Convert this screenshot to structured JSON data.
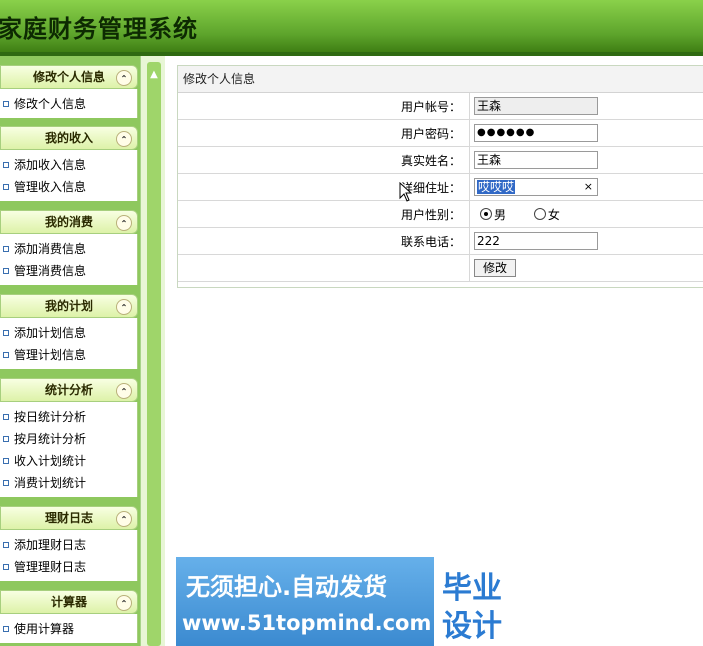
{
  "header": {
    "title": "家庭财务管理系统"
  },
  "sidebar": {
    "groups": [
      {
        "title": "修改个人信息",
        "items": [
          "修改个人信息"
        ]
      },
      {
        "title": "我的收入",
        "items": [
          "添加收入信息",
          "管理收入信息"
        ]
      },
      {
        "title": "我的消费",
        "items": [
          "添加消费信息",
          "管理消费信息"
        ]
      },
      {
        "title": "我的计划",
        "items": [
          "添加计划信息",
          "管理计划信息"
        ]
      },
      {
        "title": "统计分析",
        "items": [
          "按日统计分析",
          "按月统计分析",
          "收入计划统计",
          "消费计划统计"
        ]
      },
      {
        "title": "理财日志",
        "items": [
          "添加理财日志",
          "管理理财日志"
        ]
      },
      {
        "title": "计算器",
        "items": [
          "使用计算器"
        ]
      }
    ]
  },
  "form": {
    "panel_title": "修改个人信息",
    "fields": {
      "account": {
        "label": "用户帐号：",
        "value": "王森"
      },
      "password": {
        "label": "用户密码：",
        "value": "●●●●●●"
      },
      "real_name": {
        "label": "真实姓名：",
        "value": "王森"
      },
      "address": {
        "label": "详细住址：",
        "value": "哎哎哎",
        "clear": "×"
      },
      "gender": {
        "label": "用户性别：",
        "options": [
          "男",
          "女"
        ],
        "selected": "男"
      },
      "phone": {
        "label": "联系电话：",
        "value": "222"
      }
    },
    "submit_label": "修改"
  },
  "watermark": {
    "slogan": "无须担心.自动发货",
    "site": "www.51topmind.com",
    "badge_line1": "毕业",
    "badge_line2": "设计"
  },
  "colors": {
    "header_green": "#5ea52c",
    "sidebar_green": "#8ec85e",
    "watermark_blue": "#4a9ad8"
  }
}
